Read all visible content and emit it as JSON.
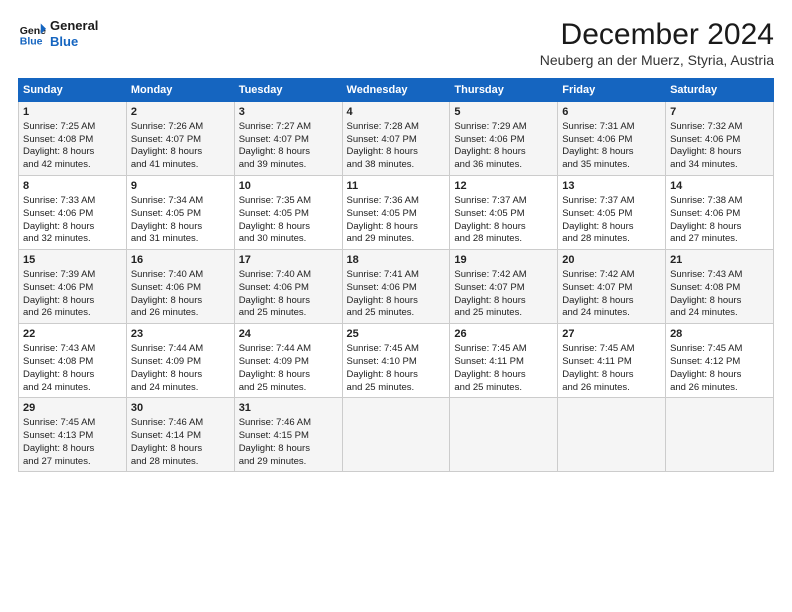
{
  "logo": {
    "line1": "General",
    "line2": "Blue"
  },
  "title": "December 2024",
  "subtitle": "Neuberg an der Muerz, Styria, Austria",
  "columns": [
    "Sunday",
    "Monday",
    "Tuesday",
    "Wednesday",
    "Thursday",
    "Friday",
    "Saturday"
  ],
  "weeks": [
    [
      {
        "day": "1",
        "text": "Sunrise: 7:25 AM\nSunset: 4:08 PM\nDaylight: 8 hours\nand 42 minutes."
      },
      {
        "day": "2",
        "text": "Sunrise: 7:26 AM\nSunset: 4:07 PM\nDaylight: 8 hours\nand 41 minutes."
      },
      {
        "day": "3",
        "text": "Sunrise: 7:27 AM\nSunset: 4:07 PM\nDaylight: 8 hours\nand 39 minutes."
      },
      {
        "day": "4",
        "text": "Sunrise: 7:28 AM\nSunset: 4:07 PM\nDaylight: 8 hours\nand 38 minutes."
      },
      {
        "day": "5",
        "text": "Sunrise: 7:29 AM\nSunset: 4:06 PM\nDaylight: 8 hours\nand 36 minutes."
      },
      {
        "day": "6",
        "text": "Sunrise: 7:31 AM\nSunset: 4:06 PM\nDaylight: 8 hours\nand 35 minutes."
      },
      {
        "day": "7",
        "text": "Sunrise: 7:32 AM\nSunset: 4:06 PM\nDaylight: 8 hours\nand 34 minutes."
      }
    ],
    [
      {
        "day": "8",
        "text": "Sunrise: 7:33 AM\nSunset: 4:06 PM\nDaylight: 8 hours\nand 32 minutes."
      },
      {
        "day": "9",
        "text": "Sunrise: 7:34 AM\nSunset: 4:05 PM\nDaylight: 8 hours\nand 31 minutes."
      },
      {
        "day": "10",
        "text": "Sunrise: 7:35 AM\nSunset: 4:05 PM\nDaylight: 8 hours\nand 30 minutes."
      },
      {
        "day": "11",
        "text": "Sunrise: 7:36 AM\nSunset: 4:05 PM\nDaylight: 8 hours\nand 29 minutes."
      },
      {
        "day": "12",
        "text": "Sunrise: 7:37 AM\nSunset: 4:05 PM\nDaylight: 8 hours\nand 28 minutes."
      },
      {
        "day": "13",
        "text": "Sunrise: 7:37 AM\nSunset: 4:05 PM\nDaylight: 8 hours\nand 28 minutes."
      },
      {
        "day": "14",
        "text": "Sunrise: 7:38 AM\nSunset: 4:06 PM\nDaylight: 8 hours\nand 27 minutes."
      }
    ],
    [
      {
        "day": "15",
        "text": "Sunrise: 7:39 AM\nSunset: 4:06 PM\nDaylight: 8 hours\nand 26 minutes."
      },
      {
        "day": "16",
        "text": "Sunrise: 7:40 AM\nSunset: 4:06 PM\nDaylight: 8 hours\nand 26 minutes."
      },
      {
        "day": "17",
        "text": "Sunrise: 7:40 AM\nSunset: 4:06 PM\nDaylight: 8 hours\nand 25 minutes."
      },
      {
        "day": "18",
        "text": "Sunrise: 7:41 AM\nSunset: 4:06 PM\nDaylight: 8 hours\nand 25 minutes."
      },
      {
        "day": "19",
        "text": "Sunrise: 7:42 AM\nSunset: 4:07 PM\nDaylight: 8 hours\nand 25 minutes."
      },
      {
        "day": "20",
        "text": "Sunrise: 7:42 AM\nSunset: 4:07 PM\nDaylight: 8 hours\nand 24 minutes."
      },
      {
        "day": "21",
        "text": "Sunrise: 7:43 AM\nSunset: 4:08 PM\nDaylight: 8 hours\nand 24 minutes."
      }
    ],
    [
      {
        "day": "22",
        "text": "Sunrise: 7:43 AM\nSunset: 4:08 PM\nDaylight: 8 hours\nand 24 minutes."
      },
      {
        "day": "23",
        "text": "Sunrise: 7:44 AM\nSunset: 4:09 PM\nDaylight: 8 hours\nand 24 minutes."
      },
      {
        "day": "24",
        "text": "Sunrise: 7:44 AM\nSunset: 4:09 PM\nDaylight: 8 hours\nand 25 minutes."
      },
      {
        "day": "25",
        "text": "Sunrise: 7:45 AM\nSunset: 4:10 PM\nDaylight: 8 hours\nand 25 minutes."
      },
      {
        "day": "26",
        "text": "Sunrise: 7:45 AM\nSunset: 4:11 PM\nDaylight: 8 hours\nand 25 minutes."
      },
      {
        "day": "27",
        "text": "Sunrise: 7:45 AM\nSunset: 4:11 PM\nDaylight: 8 hours\nand 26 minutes."
      },
      {
        "day": "28",
        "text": "Sunrise: 7:45 AM\nSunset: 4:12 PM\nDaylight: 8 hours\nand 26 minutes."
      }
    ],
    [
      {
        "day": "29",
        "text": "Sunrise: 7:45 AM\nSunset: 4:13 PM\nDaylight: 8 hours\nand 27 minutes."
      },
      {
        "day": "30",
        "text": "Sunrise: 7:46 AM\nSunset: 4:14 PM\nDaylight: 8 hours\nand 28 minutes."
      },
      {
        "day": "31",
        "text": "Sunrise: 7:46 AM\nSunset: 4:15 PM\nDaylight: 8 hours\nand 29 minutes."
      },
      {
        "day": "",
        "text": ""
      },
      {
        "day": "",
        "text": ""
      },
      {
        "day": "",
        "text": ""
      },
      {
        "day": "",
        "text": ""
      }
    ]
  ]
}
